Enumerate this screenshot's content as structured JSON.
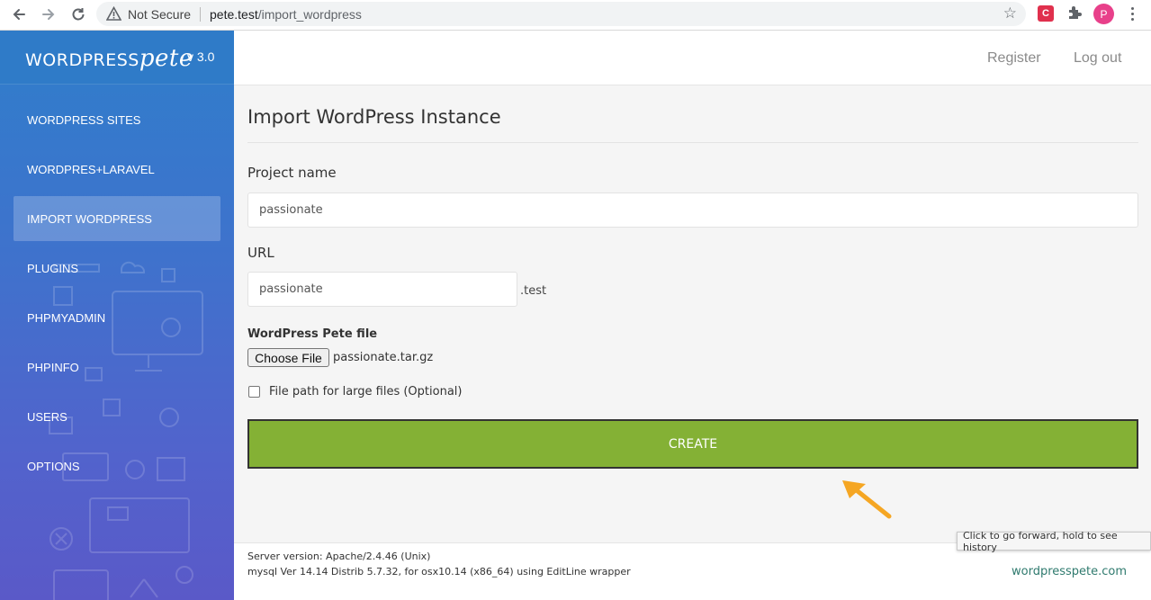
{
  "browser": {
    "security_label": "Not Secure",
    "url_host": "pete.test",
    "url_path": "/import_wordpress",
    "extension_label": "C",
    "profile_initial": "P",
    "tooltip": "Click to go forward, hold to see history"
  },
  "sidebar": {
    "logo_wordpress": "WORDPRESS",
    "logo_pete": "pete",
    "version": "v 3.0",
    "items": [
      {
        "label": "WORDPRESS SITES"
      },
      {
        "label": "WORDPRES+LARAVEL"
      },
      {
        "label": "IMPORT WORDPRESS"
      },
      {
        "label": "PLUGINS"
      },
      {
        "label": "PHPMYADMIN"
      },
      {
        "label": "PHPINFO"
      },
      {
        "label": "USERS"
      },
      {
        "label": "OPTIONS"
      }
    ],
    "active_index": 2
  },
  "header": {
    "register": "Register",
    "logout": "Log out"
  },
  "form": {
    "title": "Import WordPress Instance",
    "project_name_label": "Project name",
    "project_name_value": "passionate",
    "url_label": "URL",
    "url_value": "passionate",
    "url_suffix": ".test",
    "file_label": "WordPress Pete file",
    "choose_file": "Choose File",
    "file_name": "passionate.tar.gz",
    "large_files_label": "File path for large files (Optional)",
    "large_files_checked": false,
    "create": "CREATE"
  },
  "footer": {
    "server_version": "Server version: Apache/2.4.46 (Unix)",
    "mysql_version": "mysql Ver 14.14 Distrib 5.7.32, for osx10.14 (x86_64) using EditLine wrapper",
    "site_link": "wordpresspete.com"
  },
  "colors": {
    "sidebar_top": "#2f7ecb",
    "sidebar_bottom": "#5a59c8",
    "create_button": "#84b135",
    "annotation_arrow": "#f5a623",
    "footer_link": "#2f7a6e"
  }
}
